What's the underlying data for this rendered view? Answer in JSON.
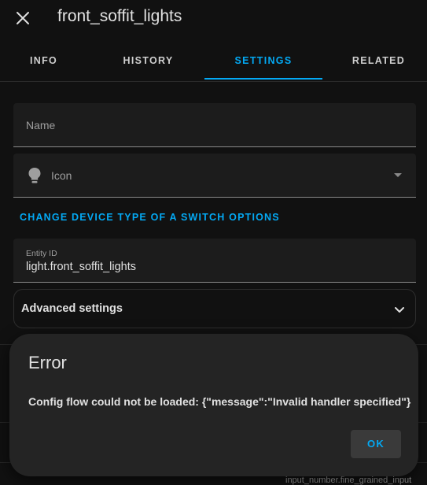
{
  "header": {
    "close_icon": "close-icon",
    "title": "front_soffit_lights"
  },
  "tabs": [
    {
      "label": "INFO",
      "active": false
    },
    {
      "label": "HISTORY",
      "active": false
    },
    {
      "label": "SETTINGS",
      "active": true
    },
    {
      "label": "RELATED",
      "active": false
    }
  ],
  "form": {
    "name_placeholder": "Name",
    "icon_placeholder": "Icon",
    "icon_name": "lightbulb-icon",
    "change_device_type": "CHANGE DEVICE TYPE OF A SWITCH OPTIONS",
    "entity_id_label": "Entity ID",
    "entity_id_value": "light.front_soffit_lights",
    "advanced_label": "Advanced settings"
  },
  "background_fragment": "input_number.fine_grained_input",
  "dialog": {
    "title": "Error",
    "message": "Config flow could not be loaded: {\"message\":\"Invalid handler specified\"}",
    "ok_label": "OK"
  },
  "colors": {
    "accent": "#03a9f4",
    "background": "#111111",
    "dialog_bg": "#242424"
  }
}
